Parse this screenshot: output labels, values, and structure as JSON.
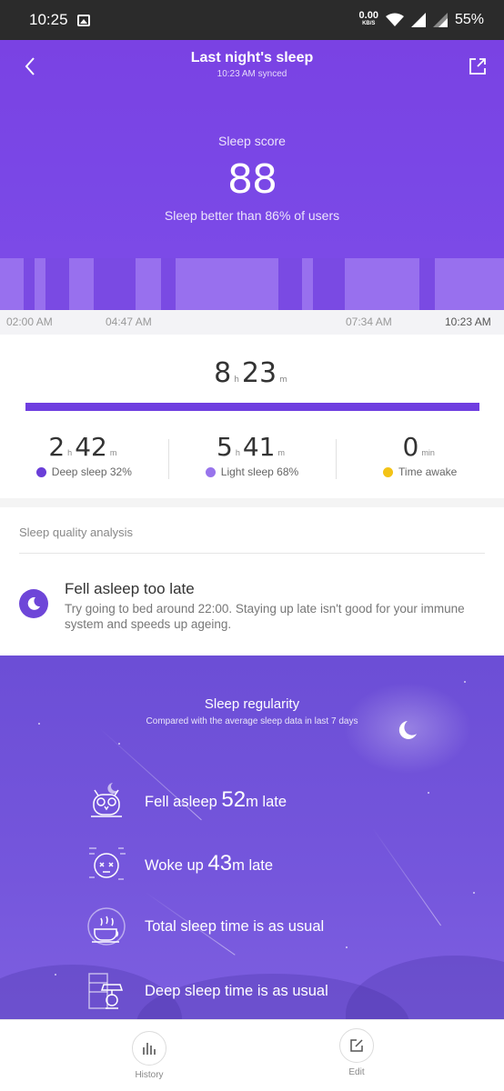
{
  "status_bar": {
    "time": "10:25",
    "net_speed": "0.00",
    "net_unit": "KB/S",
    "battery": "55%"
  },
  "header": {
    "title": "Last night's sleep",
    "synced": "10:23 AM synced",
    "score_label": "Sleep score",
    "score": "88",
    "comparison": "Sleep better than 86% of users"
  },
  "timeline": {
    "axis_labels": [
      "02:00 AM",
      "04:47 AM",
      "07:34 AM",
      "10:23 AM"
    ]
  },
  "totals": {
    "hours": "8",
    "hours_unit": "h",
    "minutes": "23",
    "minutes_unit": "m"
  },
  "stats": [
    {
      "h": "2",
      "h_unit": "h",
      "m": "42",
      "m_unit": "m",
      "label": "Deep sleep 32%",
      "color": "#6a3ed8"
    },
    {
      "h": "5",
      "h_unit": "h",
      "m": "41",
      "m_unit": "m",
      "label": "Light sleep 68%",
      "color": "#9874ec"
    },
    {
      "h": "",
      "h_unit": "",
      "m": "0",
      "m_unit": "min",
      "label": "Time awake",
      "color": "#f3c317"
    }
  ],
  "analysis": {
    "section_title": "Sleep quality analysis",
    "heading": "Fell asleep too late",
    "body": "Try going to bed around 22:00. Staying up late isn't good for your immune system and speeds up ageing."
  },
  "regularity": {
    "title": "Sleep regularity",
    "subtitle": "Compared with the average sleep data in last 7 days",
    "items": [
      {
        "pre": "Fell asleep ",
        "num": "52",
        "post": "m late",
        "icon": "owl-icon"
      },
      {
        "pre": "Woke up ",
        "num": "43",
        "post": "m late",
        "icon": "sleepy-face-icon"
      },
      {
        "pre": "Total sleep time is as usual",
        "num": "",
        "post": "",
        "icon": "coffee-cup-icon"
      },
      {
        "pre": "Deep sleep time is as usual",
        "num": "",
        "post": "",
        "icon": "night-lamp-icon"
      }
    ]
  },
  "bottom_nav": {
    "history": "History",
    "edit": "Edit"
  }
}
